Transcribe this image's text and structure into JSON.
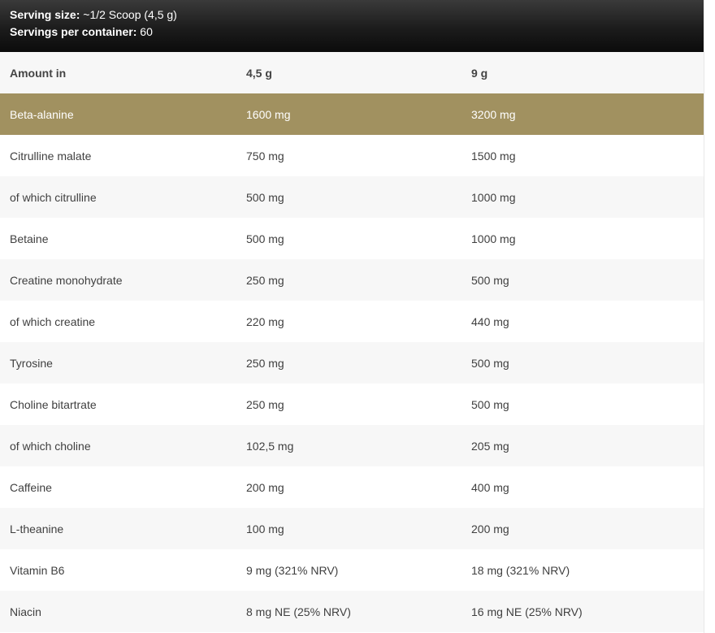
{
  "header": {
    "serving_size_label": "Serving size:",
    "serving_size_value": " ~1/2 Scoop (4,5 g)",
    "servings_label": "Servings per container:",
    "servings_value": " 60"
  },
  "table": {
    "columns": [
      "Amount in",
      "4,5 g",
      "9 g"
    ],
    "highlight_color": "#a19160",
    "rows": [
      [
        "Beta-alanine",
        "1600 mg",
        "3200 mg"
      ],
      [
        "Citrulline malate",
        "750 mg",
        "1500 mg"
      ],
      [
        "of which citrulline",
        "500 mg",
        "1000 mg"
      ],
      [
        "Betaine",
        "500 mg",
        "1000 mg"
      ],
      [
        "Creatine monohydrate",
        "250 mg",
        "500 mg"
      ],
      [
        "of which creatine",
        "220 mg",
        "440 mg"
      ],
      [
        "Tyrosine",
        "250 mg",
        "500 mg"
      ],
      [
        "Choline bitartrate",
        "250 mg",
        "500 mg"
      ],
      [
        "of which choline",
        "102,5 mg",
        "205 mg"
      ],
      [
        "Caffeine",
        "200 mg",
        "400 mg"
      ],
      [
        "L-theanine",
        "100 mg",
        "200 mg"
      ],
      [
        "Vitamin B6",
        "9 mg (321% NRV)",
        "18 mg (321% NRV)"
      ],
      [
        "Niacin",
        "8 mg NE (25% NRV)",
        "16 mg NE (25% NRV)"
      ]
    ]
  }
}
